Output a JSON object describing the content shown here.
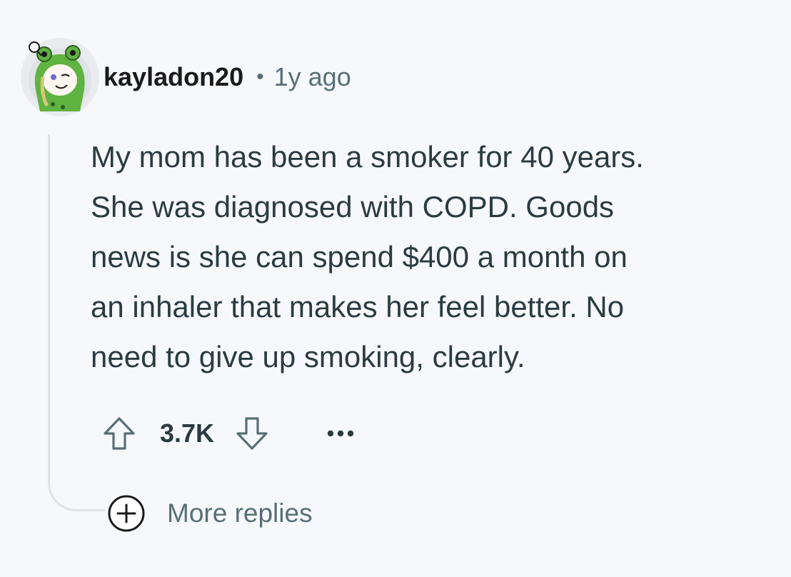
{
  "comment": {
    "author": "kayladon20",
    "separator": "•",
    "age": "1y ago",
    "avatar_icon": "frog-hood-avatar-icon",
    "body_lines": [
      "My mom has been a smoker for 40 years.",
      "She was diagnosed with COPD. Goods",
      "news is she can spend $400 a month on",
      "an inhaler that makes her feel better. No",
      "need to give up smoking, clearly."
    ],
    "score": "3.7K",
    "more_replies_label": "More replies"
  },
  "icons": {
    "upvote": "arrow-up-outline-icon",
    "downvote": "arrow-down-outline-icon",
    "overflow": "ellipsis-icon",
    "expand": "plus-circle-icon"
  },
  "colors": {
    "background": "#f7f8fb",
    "text_primary": "#1a1a1b",
    "text_body": "#2a3c42",
    "text_secondary": "#576f76",
    "thread_line": "#dfe3e8"
  }
}
